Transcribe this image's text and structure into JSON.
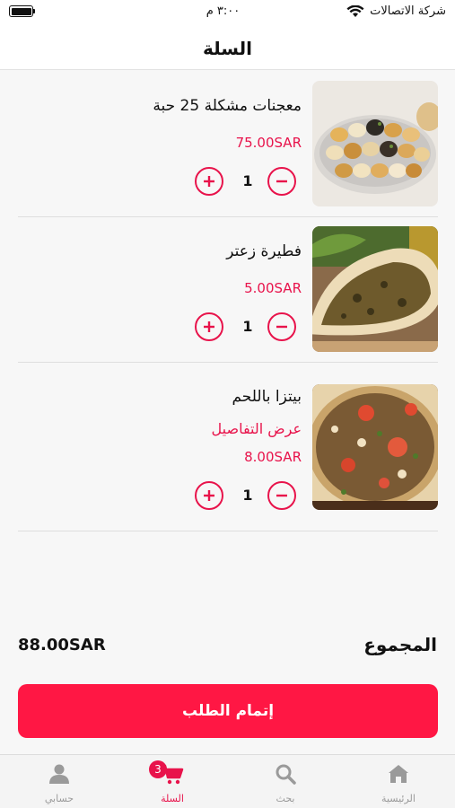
{
  "status_bar": {
    "carrier": "شركة الاتصالات",
    "time": "٣:٠٠ م",
    "battery_level": 1.0
  },
  "header": {
    "title": "السلة"
  },
  "cart": {
    "items": [
      {
        "name": "معجنات مشكلة  25 حبة",
        "price": "75.00SAR",
        "quantity": "1",
        "image": "pastries-photo"
      },
      {
        "name": "فطيرة زعتر",
        "price": "5.00SAR",
        "quantity": "1",
        "image": "zaatar-pie-photo"
      },
      {
        "name": "بيتزا باللحم",
        "details_link": "عرض التفاصيل",
        "price": "8.00SAR",
        "quantity": "1",
        "image": "meat-pizza-photo"
      }
    ]
  },
  "summary": {
    "total_label": "المجموع",
    "total_value": "88.00SAR",
    "checkout_label": "إتمام الطلب"
  },
  "tab_bar": {
    "tabs": [
      {
        "label": "الرئيسية",
        "icon": "home-icon"
      },
      {
        "label": "بحث",
        "icon": "search-icon"
      },
      {
        "label": "السلة",
        "icon": "cart-icon",
        "badge": "3",
        "active": true
      },
      {
        "label": "حسابي",
        "icon": "user-icon"
      }
    ]
  },
  "colors": {
    "accent": "#e8134b",
    "button": "#ff1744",
    "inactive_tab": "#9a9a9a"
  }
}
